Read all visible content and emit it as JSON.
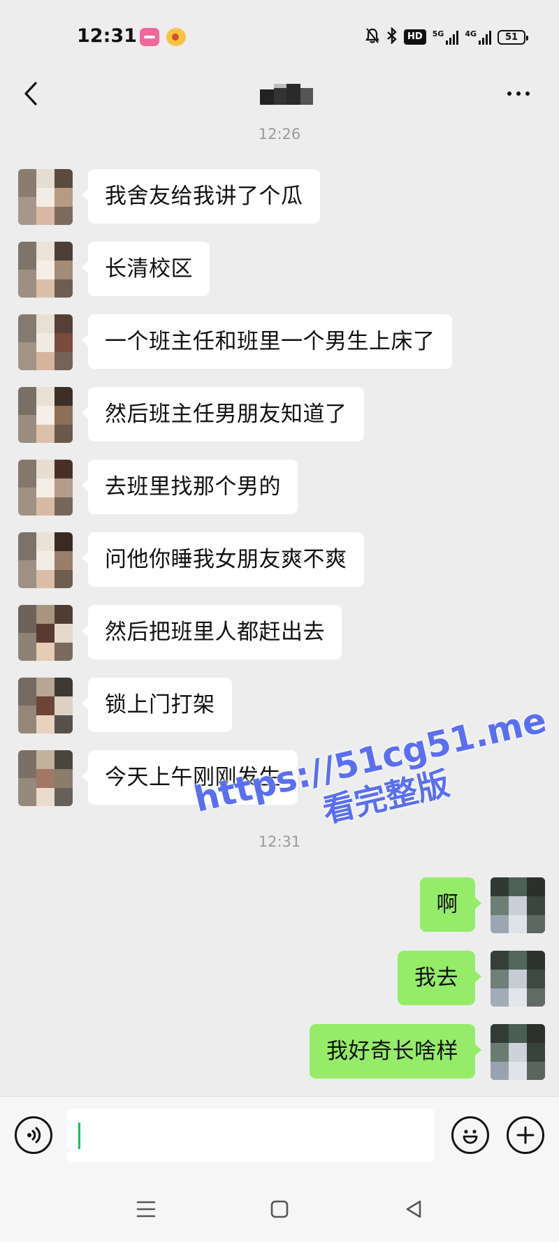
{
  "status_bar": {
    "time": "12:31",
    "hd_label": "HD",
    "network_5g": "5G",
    "network_4g": "4G",
    "battery": "51",
    "icons": [
      "app-icon-pink",
      "weibo-icon",
      "mute-bell-icon",
      "bluetooth-icon",
      "hd-icon",
      "signal-5g-icon",
      "signal-4g-icon",
      "battery-icon"
    ]
  },
  "header": {
    "back_icon": "chevron-left-icon",
    "more_icon": "more-dots-icon"
  },
  "chat": {
    "timestamp_1": "12:26",
    "timestamp_2": "12:31",
    "incoming": [
      "我舍友给我讲了个瓜",
      "长清校区",
      "一个班主任和班里一个男生上床了",
      "然后班主任男朋友知道了",
      "去班里找那个男的",
      "问他你睡我女朋友爽不爽",
      "然后把班里人都赶出去",
      "锁上门打架",
      "今天上午刚刚发生"
    ],
    "outgoing": [
      "啊",
      "我去",
      "我好奇长啥样"
    ]
  },
  "watermark": {
    "url": "https://51cg51.me",
    "text": "看完整版"
  },
  "input_bar": {
    "value": "",
    "voice_icon": "voice-icon",
    "emoji_icon": "emoji-icon",
    "plus_icon": "plus-icon"
  },
  "nav_bar": {
    "icons": [
      "menu-icon",
      "home-square-icon",
      "back-triangle-icon"
    ]
  },
  "colors": {
    "background": "#ededed",
    "incoming_bubble": "#ffffff",
    "outgoing_bubble": "#95ec69",
    "watermark": "#5a6ff0",
    "cursor": "#07c160"
  }
}
